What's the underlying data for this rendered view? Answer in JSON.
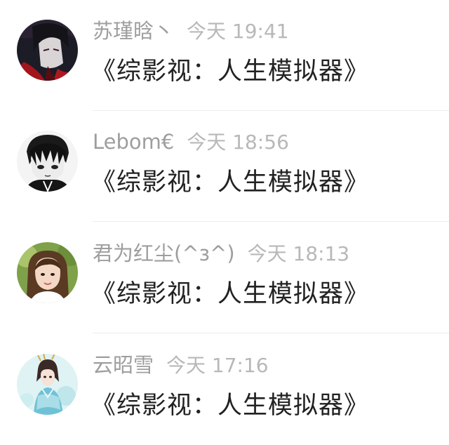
{
  "comments": [
    {
      "username": "苏瑾晗丶",
      "time": "今天 19:41",
      "text": "《综影视：人生模拟器》",
      "avatar_icon": "dark-red-anime-character-avatar"
    },
    {
      "username": "Lebom€",
      "time": "今天 18:56",
      "text": "《综影视：人生模拟器》",
      "avatar_icon": "black-white-manga-boy-avatar"
    },
    {
      "username": "君为红尘(^з^)",
      "time": "今天 18:13",
      "text": "《综影视：人生模拟器》",
      "avatar_icon": "young-woman-photo-avatar"
    },
    {
      "username": "云昭雪",
      "time": "今天 17:16",
      "text": "《综影视：人生模拟器》",
      "avatar_icon": "ancient-costume-girl-avatar"
    }
  ],
  "colors": {
    "username": "#9e9e9e",
    "time": "#b8b8b8",
    "text": "#222222",
    "divider": "#ececec"
  }
}
